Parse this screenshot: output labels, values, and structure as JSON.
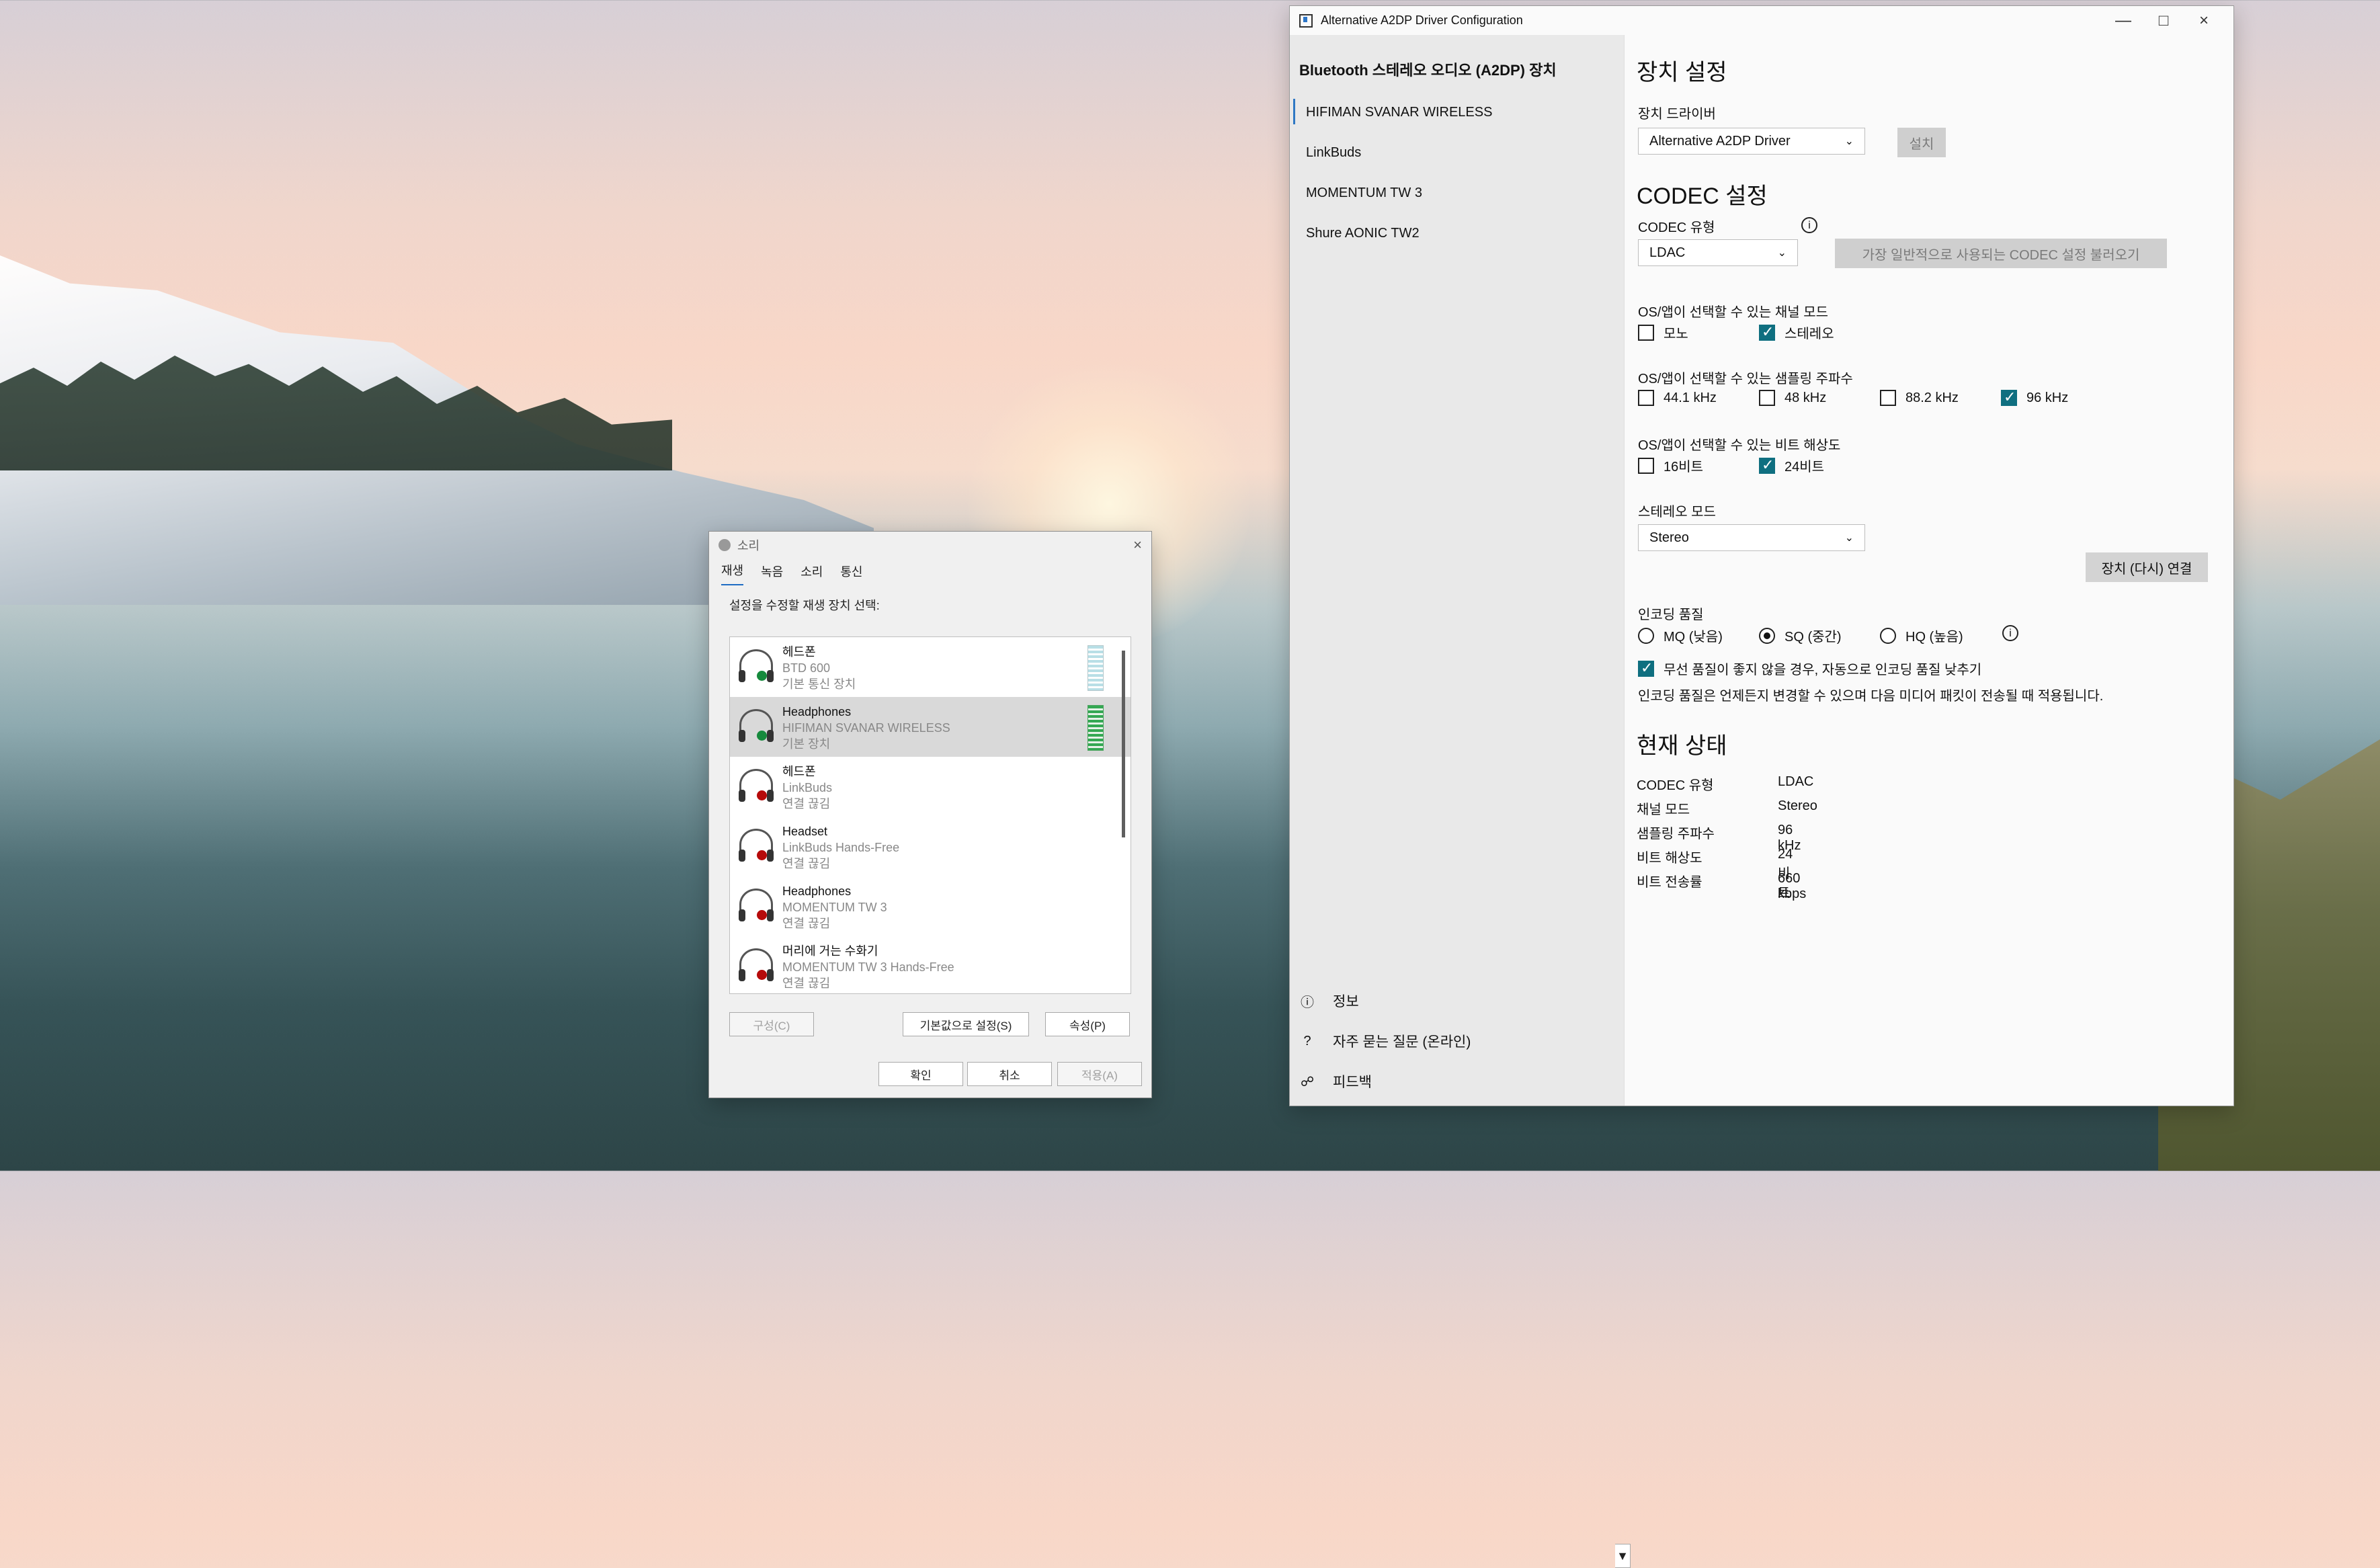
{
  "desktop": {},
  "sound_dialog": {
    "title": "소리",
    "tabs": [
      "재생",
      "녹음",
      "소리",
      "통신"
    ],
    "instruction": "설정을 수정할 재생 장치 선택:",
    "devices": [
      {
        "name": "헤드폰",
        "line2": "BTD 600",
        "line3": "기본 통신 장치",
        "status": "green",
        "level": "idle"
      },
      {
        "name": "Headphones",
        "line2": "HIFIMAN SVANAR WIRELESS",
        "line3": "기본 장치",
        "status": "green",
        "level": "active",
        "selected": true
      },
      {
        "name": "헤드폰",
        "line2": "LinkBuds",
        "line3": "연결 끊김",
        "status": "red"
      },
      {
        "name": "Headset",
        "line2": "LinkBuds Hands-Free",
        "line3": "연결 끊김",
        "status": "red"
      },
      {
        "name": "Headphones",
        "line2": "MOMENTUM TW 3",
        "line3": "연결 끊김",
        "status": "red"
      },
      {
        "name": "머리에 거는 수화기",
        "line2": "MOMENTUM TW 3 Hands-Free",
        "line3": "연결 끊김",
        "status": "red"
      }
    ],
    "buttons": {
      "configure": "구성(C)",
      "set_default": "기본값으로 설정(S)",
      "properties": "속성(P)",
      "ok": "확인",
      "cancel": "취소",
      "apply": "적용(A)"
    },
    "close_icon": "close-icon"
  },
  "a2dp_window": {
    "title": "Alternative A2DP Driver Configuration",
    "sidebar": {
      "title": "Bluetooth 스테레오 오디오 (A2DP) 장치",
      "devices": [
        "HIFIMAN SVANAR WIRELESS",
        "LinkBuds",
        "MOMENTUM TW 3",
        "Shure AONIC TW2"
      ],
      "footer": [
        {
          "icon": "info-icon",
          "label": "정보"
        },
        {
          "icon": "question-icon",
          "label": "자주 묻는 질문 (온라인)"
        },
        {
          "icon": "feedback-icon",
          "label": "피드백"
        }
      ]
    },
    "device_settings": {
      "title": "장치 설정",
      "driver_label": "장치 드라이버",
      "driver_value": "Alternative A2DP Driver",
      "install_button": "설치"
    },
    "codec_settings": {
      "title": "CODEC 설정",
      "codec_type_label": "CODEC 유형",
      "codec_value": "LDAC",
      "load_common_button": "가장 일반적으로 사용되는 CODEC 설정 불러오기",
      "channel_mode_label": "OS/앱이 선택할 수 있는 채널 모드",
      "channel_modes": [
        {
          "label": "모노",
          "checked": false
        },
        {
          "label": "스테레오",
          "checked": true
        }
      ],
      "sampling_label": "OS/앱이 선택할 수 있는 샘플링 주파수",
      "sampling_rates": [
        {
          "label": "44.1 kHz",
          "checked": false
        },
        {
          "label": "48 kHz",
          "checked": false
        },
        {
          "label": "88.2 kHz",
          "checked": false
        },
        {
          "label": "96 kHz",
          "checked": true
        }
      ],
      "bit_depth_label": "OS/앱이 선택할 수 있는 비트 해상도",
      "bit_depths": [
        {
          "label": "16비트",
          "checked": false
        },
        {
          "label": "24비트",
          "checked": true
        }
      ],
      "stereo_mode_label": "스테레오 모드",
      "stereo_mode_value": "Stereo",
      "reconnect_button": "장치 (다시) 연결",
      "encoding_quality_label": "인코딩 품질",
      "encoding_options": [
        {
          "label": "MQ (낮음)",
          "checked": false
        },
        {
          "label": "SQ (중간)",
          "checked": true
        },
        {
          "label": "HQ (높음)",
          "checked": false
        }
      ],
      "auto_lower_label": "무선 품질이 좋지 않을 경우, 자동으로 인코딩 품질 낮추기",
      "auto_lower_checked": true,
      "encoding_note": "인코딩 품질은 언제든지 변경할 수 있으며 다음 미디어 패킷이 전송될 때 적용됩니다."
    },
    "current_status": {
      "title": "현재 상태",
      "rows": [
        {
          "label": "CODEC 유형",
          "value": "LDAC"
        },
        {
          "label": "채널 모드",
          "value": "Stereo"
        },
        {
          "label": "샘플링 주파수",
          "value": "96 kHz"
        },
        {
          "label": "비트 해상도",
          "value": "24비트"
        },
        {
          "label": "비트 전송률",
          "value": "660 kbps"
        }
      ]
    }
  }
}
